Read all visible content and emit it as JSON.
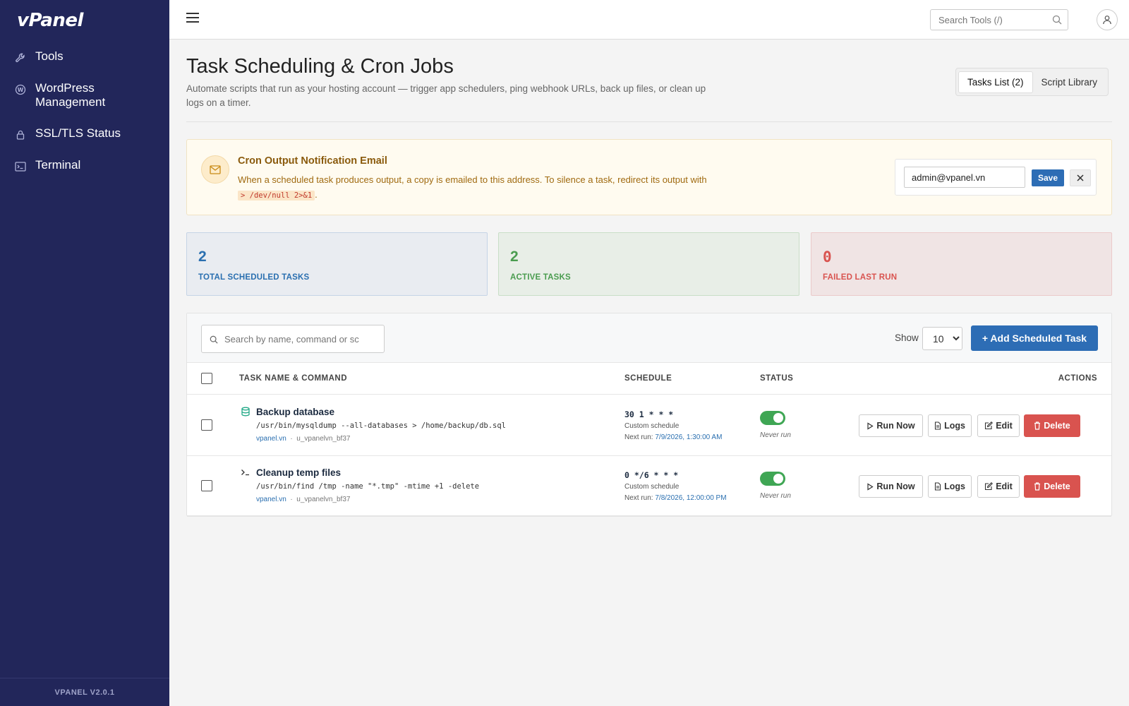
{
  "app": {
    "logo": "vPanel",
    "version": "VPANEL V2.0.1"
  },
  "sidebar": {
    "items": [
      {
        "label": "Tools",
        "icon": "wrench-icon"
      },
      {
        "label": "WordPress Management",
        "icon": "wordpress-icon"
      },
      {
        "label": "SSL/TLS Status",
        "icon": "lock-icon"
      },
      {
        "label": "Terminal",
        "icon": "terminal-icon"
      }
    ]
  },
  "topbar": {
    "search_placeholder": "Search Tools (/)"
  },
  "page": {
    "title": "Task Scheduling & Cron Jobs",
    "description": "Automate scripts that run as your hosting account — trigger app schedulers, ping webhook URLs, back up files, or clean up logs on a timer.",
    "tabs": [
      {
        "label": "Tasks List (2)",
        "active": true
      },
      {
        "label": "Script Library",
        "active": false
      }
    ]
  },
  "notification": {
    "title": "Cron Output Notification Email",
    "text": "When a scheduled task produces output, a copy is emailed to this address. To silence a task, redirect its output with",
    "code": "> /dev/null 2>&1",
    "suffix": ".",
    "email": "admin@vpanel.vn",
    "save_label": "Save"
  },
  "stats": [
    {
      "value": "2",
      "label": "TOTAL SCHEDULED TASKS"
    },
    {
      "value": "2",
      "label": "ACTIVE TASKS"
    },
    {
      "value": "0",
      "label": "FAILED LAST RUN"
    }
  ],
  "table": {
    "search_placeholder": "Search by name, command or sc",
    "show_label": "Show",
    "page_size": "10",
    "add_label": "+ Add Scheduled Task",
    "columns": [
      "TASK NAME & COMMAND",
      "SCHEDULE",
      "STATUS",
      "ACTIONS"
    ],
    "rows": [
      {
        "icon": "database-icon",
        "name": "Backup database",
        "command": "/usr/bin/mysqldump --all-databases > /home/backup/db.sql",
        "domain": "vpanel.vn",
        "user": "u_vpanelvn_bf37",
        "cron": "30 1 * * *",
        "schedule_type": "Custom schedule",
        "next_run_label": "Next run:",
        "next_run": "7/9/2026, 1:30:00 AM",
        "enabled": true,
        "last_run": "Never run"
      },
      {
        "icon": "terminal-icon",
        "name": "Cleanup temp files",
        "command": "/usr/bin/find /tmp -name \"*.tmp\" -mtime +1 -delete",
        "domain": "vpanel.vn",
        "user": "u_vpanelvn_bf37",
        "cron": "0 */6 * * *",
        "schedule_type": "Custom schedule",
        "next_run_label": "Next run:",
        "next_run": "7/8/2026, 12:00:00 PM",
        "enabled": true,
        "last_run": "Never run"
      }
    ],
    "actions": {
      "run": "Run Now",
      "logs": "Logs",
      "edit": "Edit",
      "delete": "Delete"
    }
  },
  "colors": {
    "sidebar_bg": "#22265a",
    "primary": "#2d6db5",
    "success": "#3fa654",
    "danger": "#d9534f",
    "warning_bg": "#fffbf0"
  }
}
